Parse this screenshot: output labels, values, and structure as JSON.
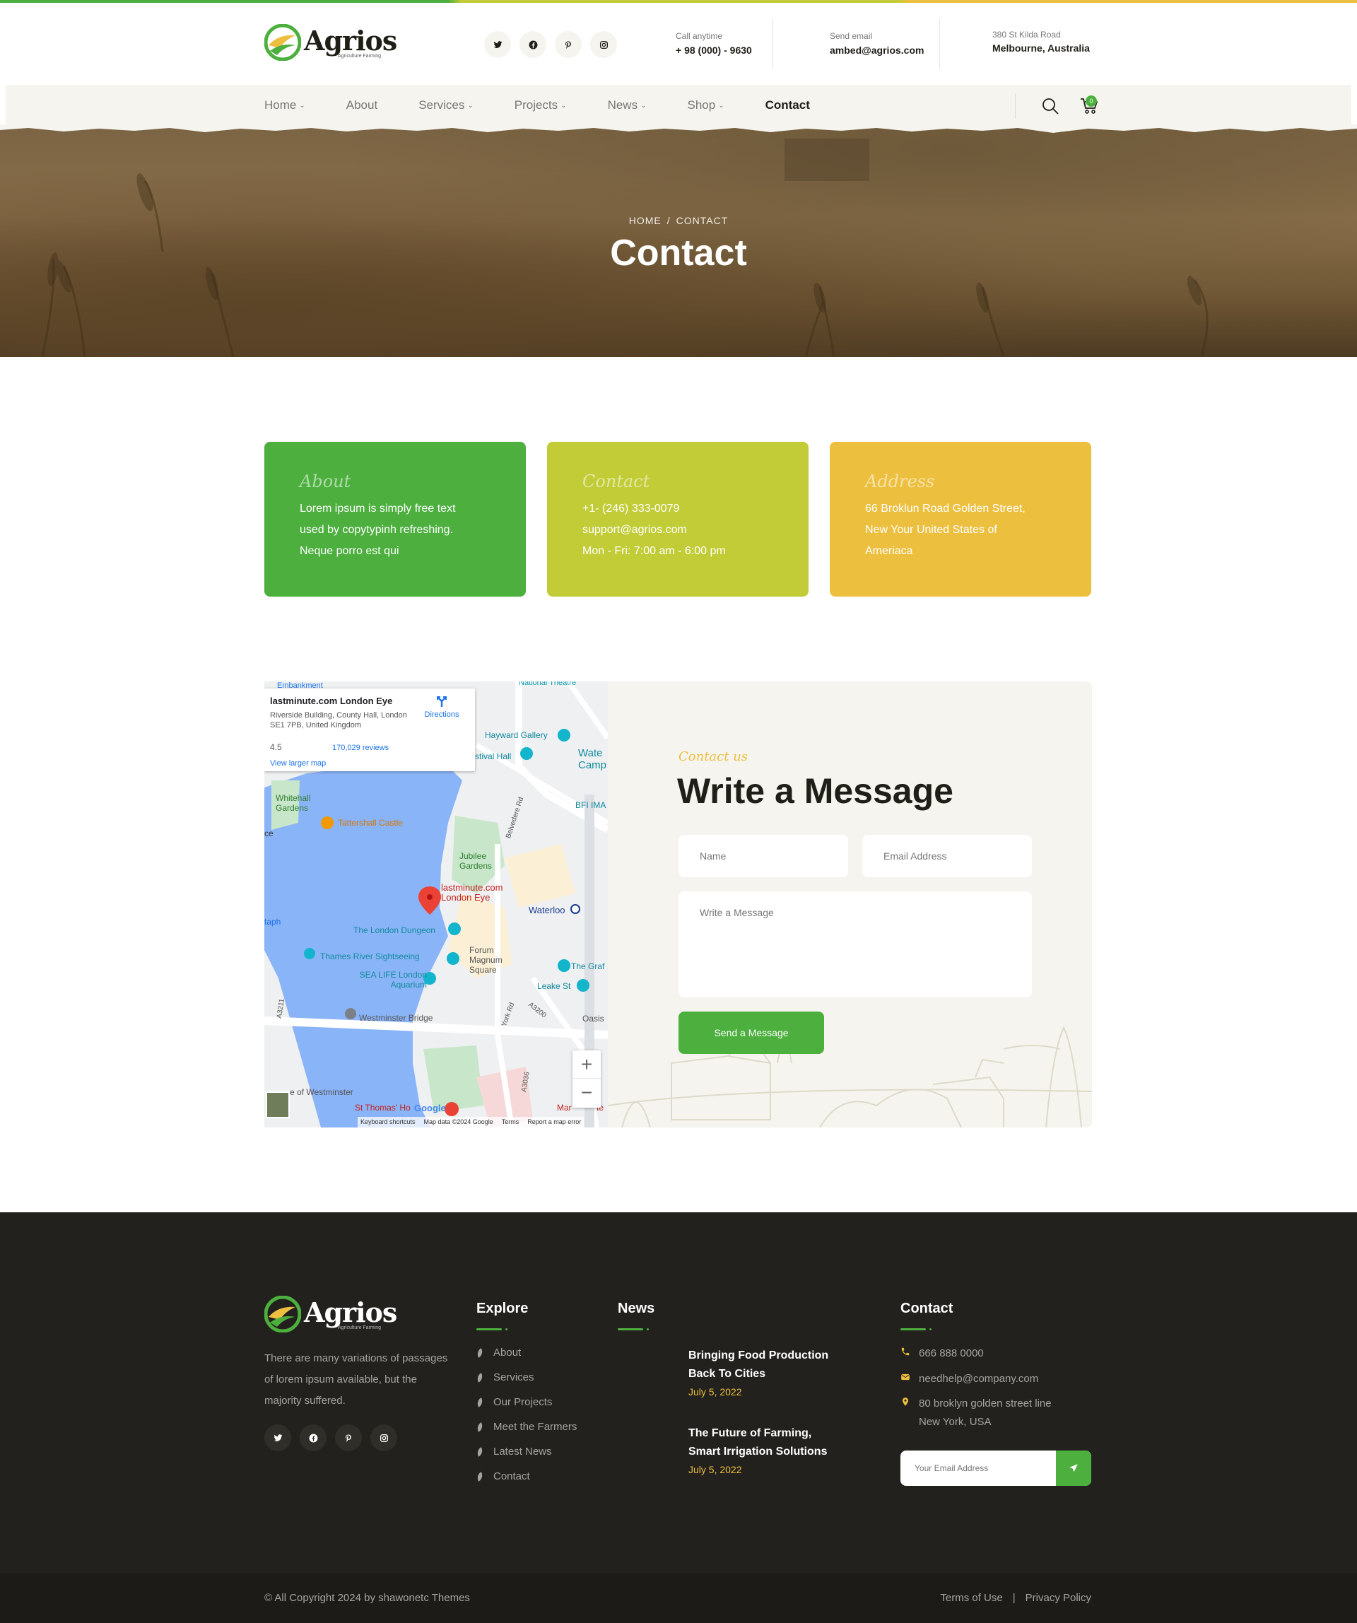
{
  "colors": {
    "green": "#4caf3e",
    "lime": "#c2cc37",
    "yellow": "#edbf3f",
    "dark": "#22211d",
    "cream": "#f5f4ee"
  },
  "brand": {
    "name": "Agrios",
    "tagline": "Agriculture Farming"
  },
  "header": {
    "socials": [
      "twitter-icon",
      "facebook-icon",
      "pinterest-icon",
      "instagram-icon"
    ],
    "call": {
      "label": "Call anytime",
      "value": "+ 98 (000) - 9630"
    },
    "email": {
      "label": "Send email",
      "value": "ambed@agrios.com"
    },
    "address": {
      "label": "380 St Kilda Road",
      "value": "Melbourne, Australia"
    }
  },
  "nav": {
    "items": [
      {
        "label": "Home",
        "dropdown": true
      },
      {
        "label": "About",
        "dropdown": false
      },
      {
        "label": "Services",
        "dropdown": true
      },
      {
        "label": "Projects",
        "dropdown": true
      },
      {
        "label": "News",
        "dropdown": true
      },
      {
        "label": "Shop",
        "dropdown": true
      },
      {
        "label": "Contact",
        "dropdown": false,
        "active": true
      }
    ],
    "cart_count": "0"
  },
  "hero": {
    "crumb_home": "HOME",
    "crumb_sep": "/",
    "crumb_current": "CONTACT",
    "title": "Contact"
  },
  "info_boxes": [
    {
      "title": "About",
      "lines": [
        "Lorem ipsum is simply free text",
        "used by copytypinh refreshing.",
        "Neque porro est qui"
      ]
    },
    {
      "title": "Contact",
      "lines": [
        "+1- (246) 333-0079",
        "support@agrios.com",
        "Mon - Fri: 7:00 am - 6:00 pm"
      ]
    },
    {
      "title": "Address",
      "lines": [
        "66 Broklun Road Golden Street,",
        "New Your United States of",
        "Ameriaca"
      ]
    }
  ],
  "map": {
    "place_title": "lastminute.com London Eye",
    "place_address": "Riverside Building, County Hall, London SE1 7PB, United Kingdom",
    "rating": "4.5",
    "reviews": "170,029 reviews",
    "directions": "Directions",
    "view_larger": "View larger map",
    "labels": {
      "embankment": "Embankment",
      "national_theatre": "National Theatre",
      "hayward": "Hayward Gallery",
      "festival": "stival Hall",
      "waterloo_camp": "Wate Camp",
      "bfi": "BFI IMA",
      "whitehall": "Whitehall Gardens",
      "tattershall": "Tattershall Castle",
      "jubilee": "Jubilee Gardens",
      "belvedere": "Belvedere Rd",
      "pin": "lastminute.com London Eye",
      "waterloo": "Waterloo",
      "dungeon": "The London Dungeon",
      "thames": "Thames River Sightseeing",
      "forum": "Forum Magnum Square",
      "sealife": "SEA LIFE London Aquarium",
      "graf": "The Graf",
      "leake": "Leake St",
      "a3211": "A3211",
      "york": "York Rd",
      "a3200": "A3200",
      "oasis": "Oasis",
      "westminster_bridge": "Westminster Bridge",
      "a3036": "A3036",
      "palace": "e of Westminster",
      "st_thomas": "St Thomas' Ho",
      "mar": "Mar",
      "taph": "taph",
      "ce": "ce",
      "te": "te"
    },
    "footer": [
      "Keyboard shortcuts",
      "Map data ©2024 Google",
      "Terms",
      "Report a map error"
    ],
    "google": "Google",
    "zoom_in": "+",
    "zoom_out": "−"
  },
  "form": {
    "tagline": "Contact us",
    "title": "Write a Message",
    "name_placeholder": "Name",
    "email_placeholder": "Email Address",
    "message_placeholder": "Write a Message",
    "submit": "Send a Message"
  },
  "footer": {
    "description": "There are many variations of passages of lorem ipsum available, but the majority suffered.",
    "explore_title": "Explore",
    "explore_links": [
      "About",
      "Services",
      "Our Projects",
      "Meet the Farmers",
      "Latest News",
      "Contact"
    ],
    "news_title": "News",
    "news": [
      {
        "title": "Bringing Food Production Back To Cities",
        "date": "July 5, 2022"
      },
      {
        "title": "The Future of Farming, Smart Irrigation Solutions",
        "date": "July 5, 2022"
      }
    ],
    "contact_title": "Contact",
    "phone": "666 888 0000",
    "email": "needhelp@company.com",
    "address_1": "80 broklyn golden street line",
    "address_2": "New York, USA",
    "newsletter_placeholder": "Your Email Address",
    "copyright": "© All Copyright 2024 by shawonetc Themes",
    "terms": "Terms of Use",
    "sep": "|",
    "privacy": "Privacy Policy"
  }
}
